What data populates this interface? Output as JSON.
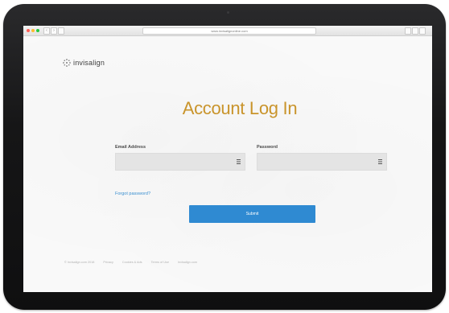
{
  "browser": {
    "address": "www.invisalignonline.com",
    "back_icon": "chevron-left-icon",
    "forward_icon": "chevron-right-icon"
  },
  "brand": {
    "logo_text": "invisalign",
    "accent_color": "#c9942b",
    "button_color": "#2f8ad2"
  },
  "login": {
    "title": "Account Log In",
    "email_label": "Email Address",
    "email_value": "",
    "password_label": "Password",
    "password_value": "",
    "forgot_label": "Forgot password?",
    "submit_label": "Submit"
  },
  "footer": {
    "links": [
      "© Invisalign.com 2018",
      "Privacy",
      "Cookies & Ads",
      "Terms of Use",
      "Invisalign.com"
    ]
  }
}
